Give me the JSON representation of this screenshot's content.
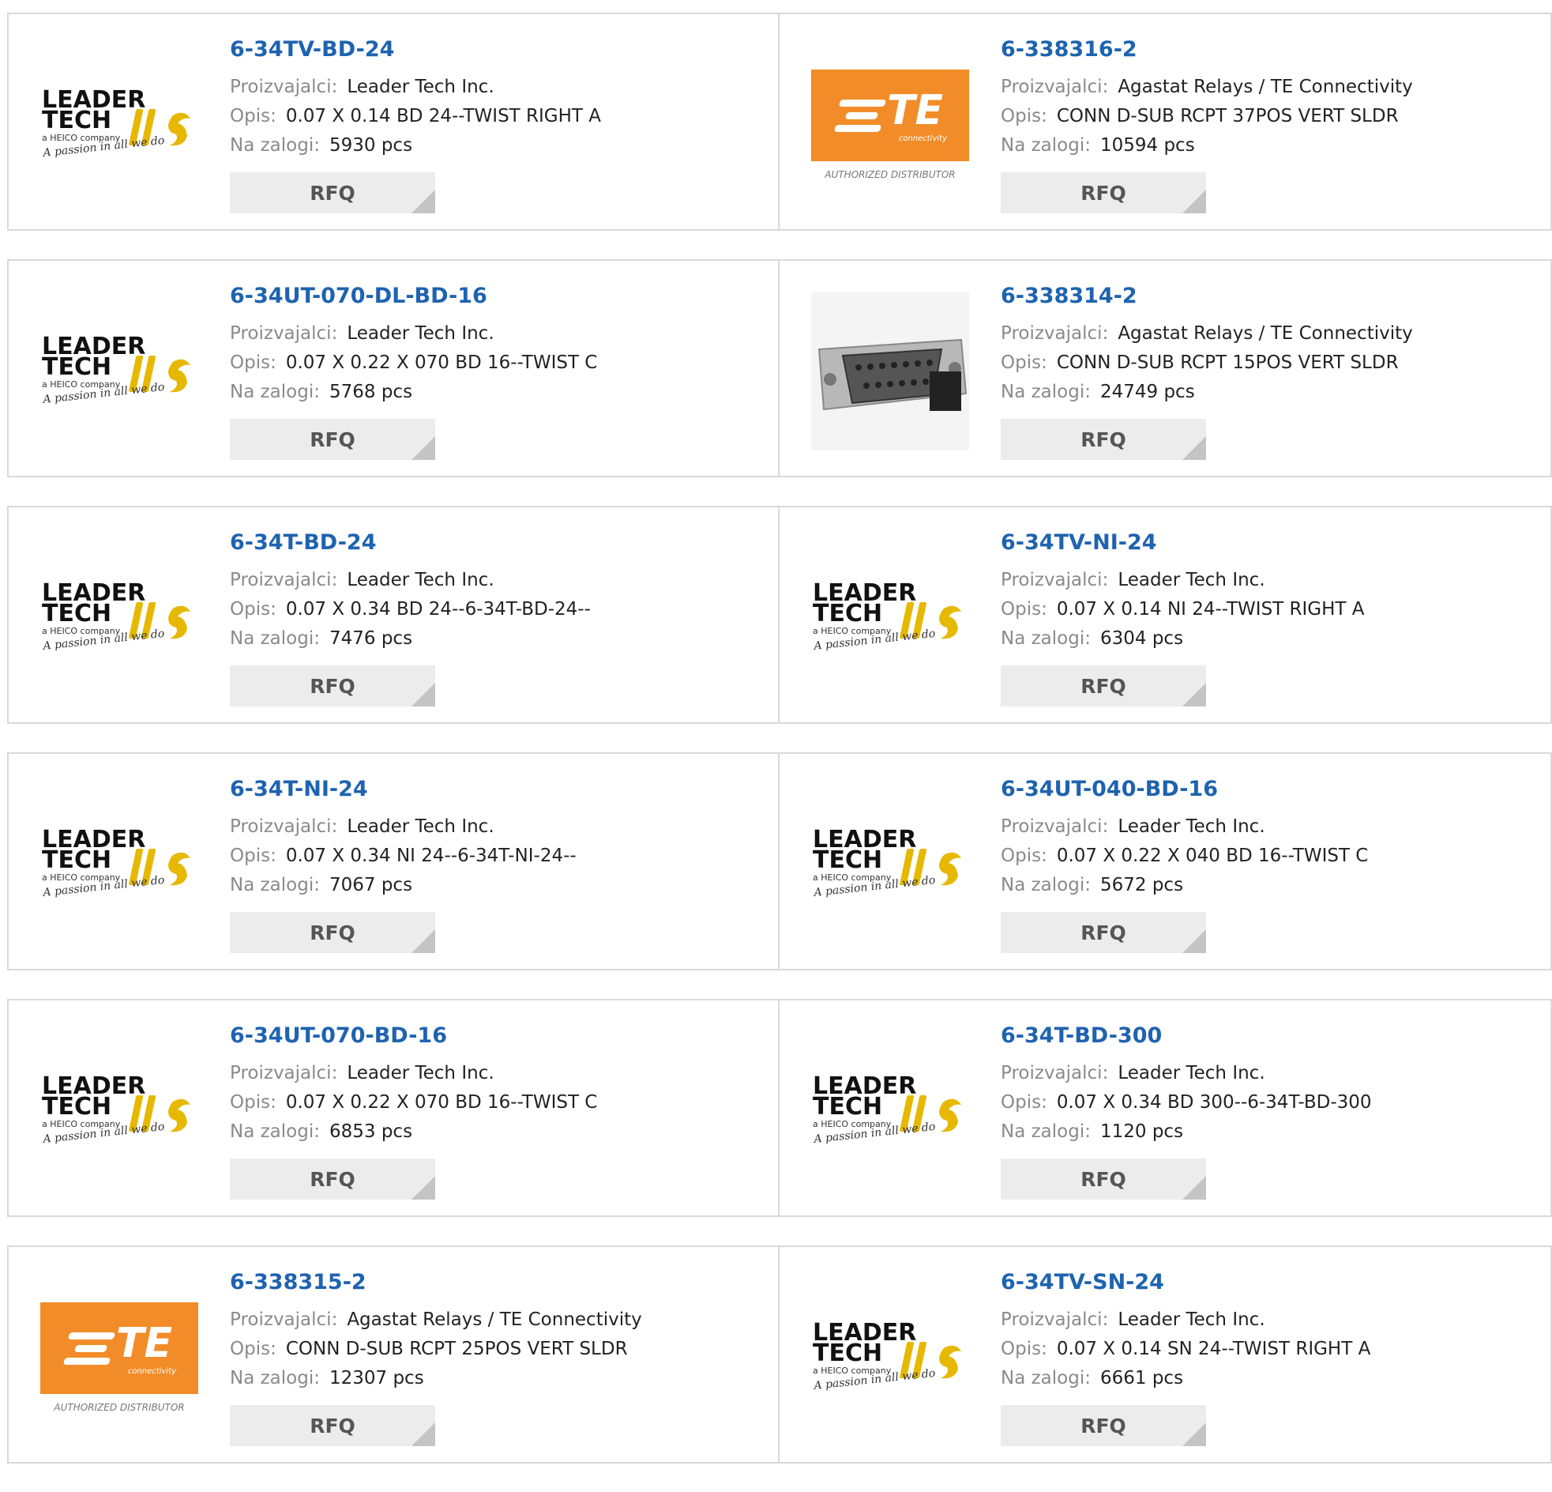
{
  "labels": {
    "manufacturer": "Proizvajalci:",
    "description": "Opis:",
    "stock": "Na zalogi:",
    "rfq": "RFQ"
  },
  "brand_assets": {
    "leadertech": {
      "line1": "LEADER",
      "line2": "TECH",
      "tagline": "a HEICO company",
      "slogan": "A passion in all we do",
      "accent": "#e6b800"
    },
    "te": {
      "letters": "TE",
      "sub": "connectivity",
      "caption": "AUTHORIZED DISTRIBUTOR",
      "bg": "#f28c28"
    }
  },
  "products": [
    {
      "part": "6-34TV-BD-24",
      "manufacturer": "Leader Tech Inc.",
      "description": "0.07 X 0.14 BD 24--TWIST RIGHT A",
      "stock": "5930 pcs",
      "logo": "leadertech"
    },
    {
      "part": "6-338316-2",
      "manufacturer": "Agastat Relays / TE Connectivity",
      "description": "CONN D-SUB RCPT 37POS VERT SLDR",
      "stock": "10594 pcs",
      "logo": "te"
    },
    {
      "part": "6-34UT-070-DL-BD-16",
      "manufacturer": "Leader Tech Inc.",
      "description": "0.07 X 0.22 X 070 BD 16--TWIST C",
      "stock": "5768 pcs",
      "logo": "leadertech"
    },
    {
      "part": "6-338314-2",
      "manufacturer": "Agastat Relays / TE Connectivity",
      "description": "CONN D-SUB RCPT 15POS VERT SLDR",
      "stock": "24749 pcs",
      "logo": "dsub"
    },
    {
      "part": "6-34T-BD-24",
      "manufacturer": "Leader Tech Inc.",
      "description": "0.07 X 0.34 BD 24--6-34T-BD-24--",
      "stock": "7476 pcs",
      "logo": "leadertech"
    },
    {
      "part": "6-34TV-NI-24",
      "manufacturer": "Leader Tech Inc.",
      "description": "0.07 X 0.14 NI 24--TWIST RIGHT A",
      "stock": "6304 pcs",
      "logo": "leadertech"
    },
    {
      "part": "6-34T-NI-24",
      "manufacturer": "Leader Tech Inc.",
      "description": "0.07 X 0.34 NI 24--6-34T-NI-24--",
      "stock": "7067 pcs",
      "logo": "leadertech"
    },
    {
      "part": "6-34UT-040-BD-16",
      "manufacturer": "Leader Tech Inc.",
      "description": "0.07 X 0.22 X 040 BD 16--TWIST C",
      "stock": "5672 pcs",
      "logo": "leadertech"
    },
    {
      "part": "6-34UT-070-BD-16",
      "manufacturer": "Leader Tech Inc.",
      "description": "0.07 X 0.22 X 070 BD 16--TWIST C",
      "stock": "6853 pcs",
      "logo": "leadertech"
    },
    {
      "part": "6-34T-BD-300",
      "manufacturer": "Leader Tech Inc.",
      "description": "0.07 X 0.34 BD 300--6-34T-BD-300",
      "stock": "1120 pcs",
      "logo": "leadertech"
    },
    {
      "part": "6-338315-2",
      "manufacturer": "Agastat Relays / TE Connectivity",
      "description": "CONN D-SUB RCPT 25POS VERT SLDR",
      "stock": "12307 pcs",
      "logo": "te"
    },
    {
      "part": "6-34TV-SN-24",
      "manufacturer": "Leader Tech Inc.",
      "description": "0.07 X 0.14 SN 24--TWIST RIGHT A",
      "stock": "6661 pcs",
      "logo": "leadertech"
    }
  ]
}
